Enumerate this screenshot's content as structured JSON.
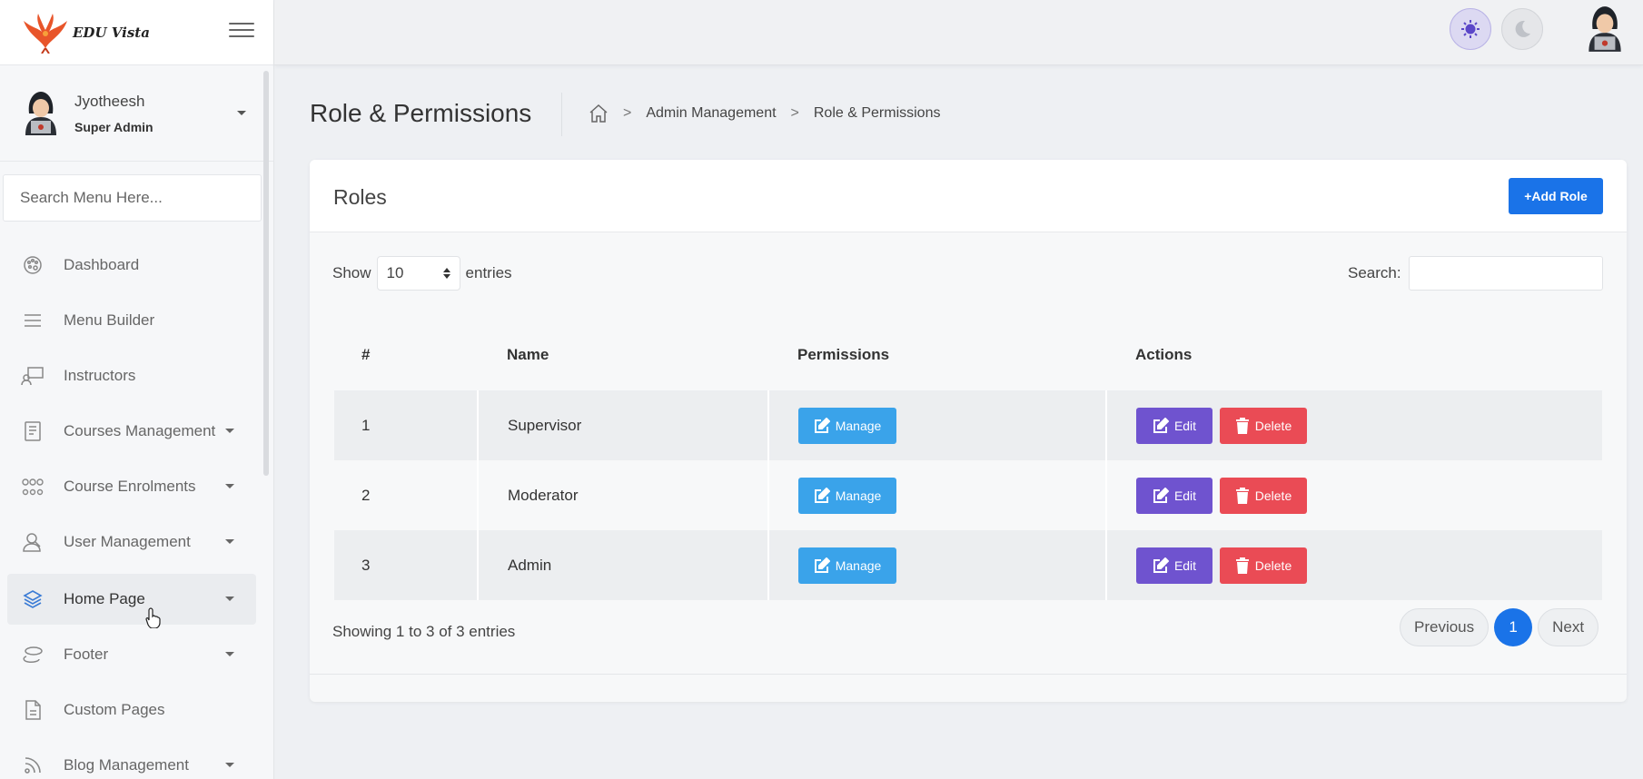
{
  "app": {
    "logo_text": "EDU Vista"
  },
  "user": {
    "name": "Jyotheesh",
    "role": "Super Admin"
  },
  "sidebar": {
    "search_placeholder": "Search Menu Here...",
    "items": [
      {
        "label": "Dashboard",
        "icon": "palette-icon"
      },
      {
        "label": "Menu Builder",
        "icon": "list-icon"
      },
      {
        "label": "Instructors",
        "icon": "presenter-icon"
      },
      {
        "label": "Courses Management",
        "icon": "book-icon"
      },
      {
        "label": "Course Enrolments",
        "icon": "group-icon"
      },
      {
        "label": "User Management",
        "icon": "user-icon"
      },
      {
        "label": "Home Page",
        "icon": "layers-icon"
      },
      {
        "label": "Footer",
        "icon": "footer-icon"
      },
      {
        "label": "Custom Pages",
        "icon": "page-icon"
      },
      {
        "label": "Blog Management",
        "icon": "rss-icon"
      }
    ]
  },
  "header": {
    "title": "Role & Permissions",
    "breadcrumb": [
      "Admin Management",
      "Role & Permissions"
    ],
    "bc_sep": ">"
  },
  "card": {
    "title": "Roles",
    "add_button": "+Add Role",
    "show_label": "Show",
    "entries_value": "10",
    "entries_label": "entries",
    "search_label": "Search:"
  },
  "table": {
    "columns": [
      "#",
      "Name",
      "Permissions",
      "Actions"
    ],
    "rows": [
      {
        "num": "1",
        "name": "Supervisor"
      },
      {
        "num": "2",
        "name": "Moderator"
      },
      {
        "num": "3",
        "name": "Admin"
      }
    ],
    "manage_label": "Manage",
    "edit_label": "Edit",
    "delete_label": "Delete"
  },
  "footer": {
    "showing": "Showing 1 to 3 of 3 entries",
    "previous": "Previous",
    "page": "1",
    "next": "Next"
  },
  "colors": {
    "primary": "#1a73e8",
    "manage": "#3aa3ea",
    "edit": "#6f53cf",
    "delete": "#ea4b55"
  }
}
